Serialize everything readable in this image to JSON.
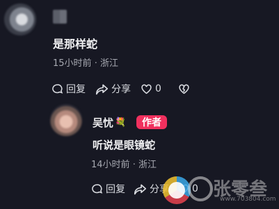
{
  "comment": {
    "text": "是那样蛇",
    "time": "15小时前",
    "location": "浙江",
    "actions": {
      "reply": "回复",
      "share": "分享",
      "likes": "0"
    }
  },
  "reply": {
    "author": "吴忧",
    "author_emoji": "💐",
    "badge": "作者",
    "text": "听说是眼镜蛇",
    "time": "14小时前",
    "location": "浙江",
    "actions": {
      "reply": "回复",
      "share": "分享",
      "likes": "0"
    }
  },
  "watermark": {
    "brand": "张零叁",
    "url": "www.703804.com"
  },
  "colors": {
    "background": "#171823",
    "badge": "#f0305e"
  }
}
